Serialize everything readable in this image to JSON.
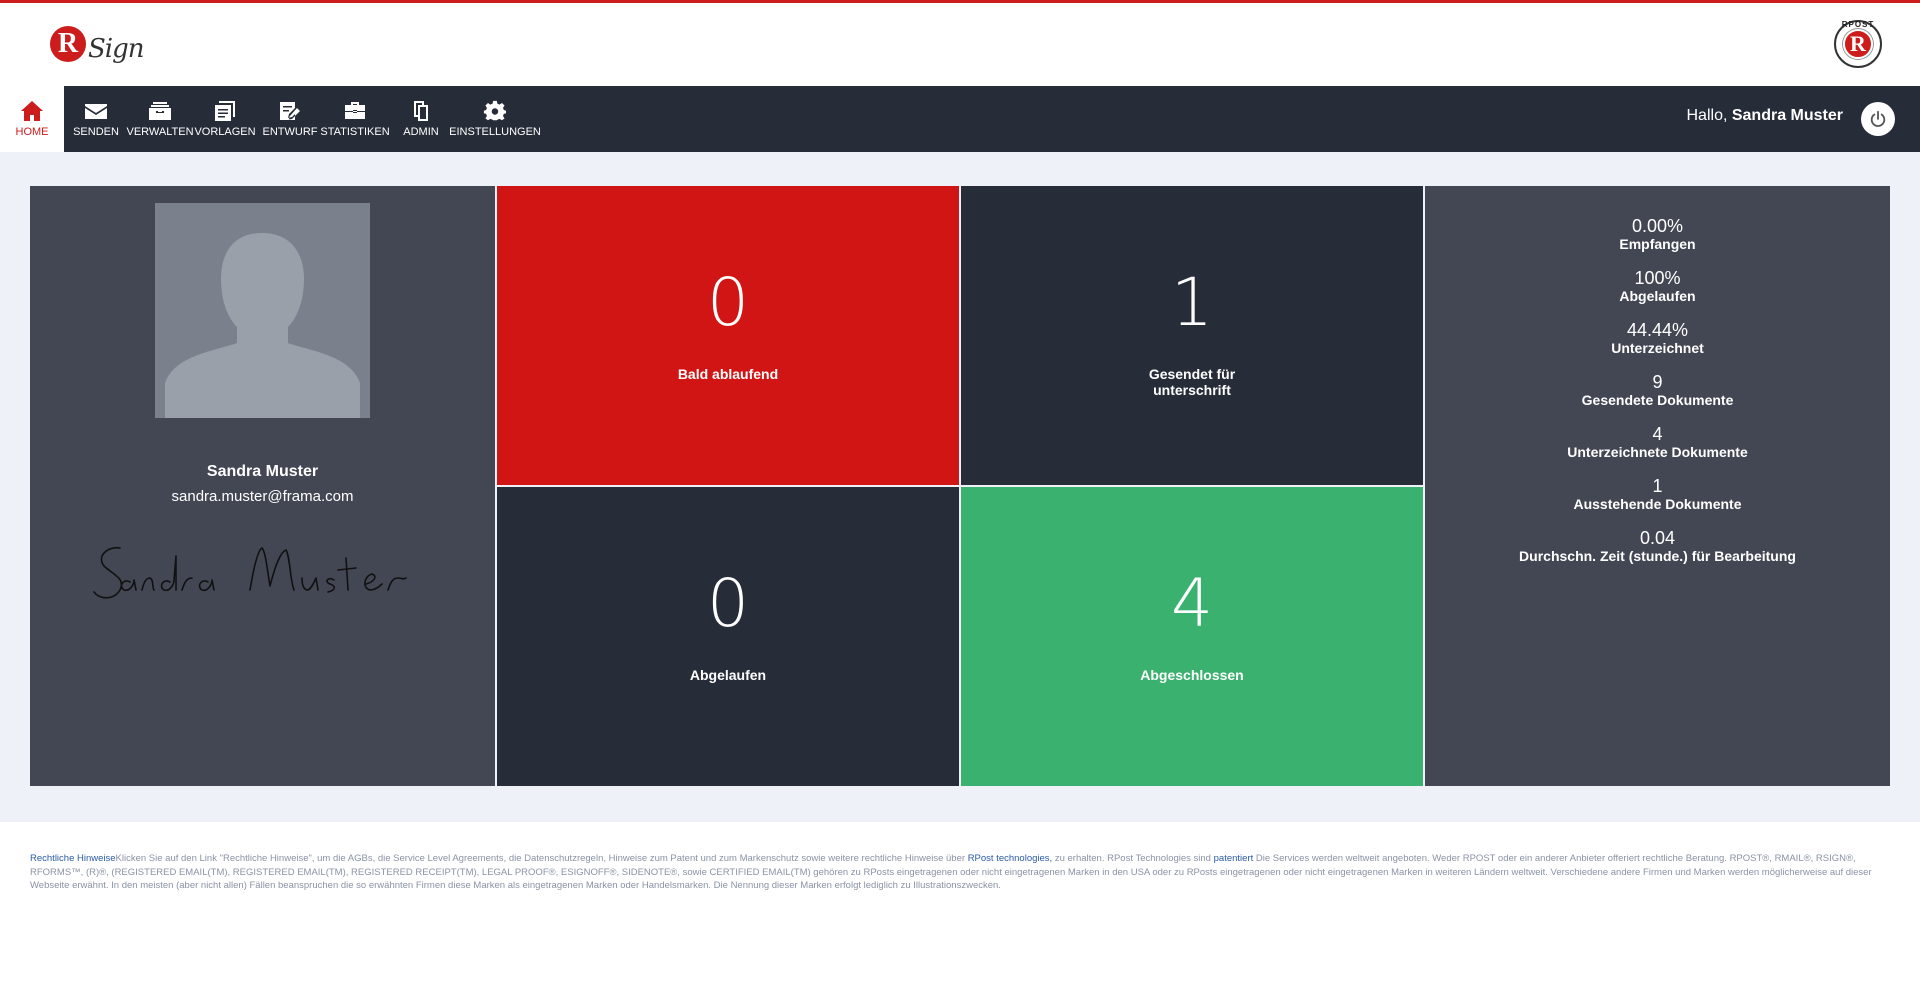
{
  "brand": {
    "logo_letter": "R",
    "logo_text": "Sign",
    "partner_letter": "R",
    "partner_text": "RPOST"
  },
  "nav": {
    "items": [
      {
        "label": "HOME",
        "icon": "home-icon"
      },
      {
        "label": "SENDEN",
        "icon": "envelope-icon"
      },
      {
        "label": "VERWALTEN",
        "icon": "inbox-icon"
      },
      {
        "label": "VORLAGEN",
        "icon": "templates-icon"
      },
      {
        "label": "ENTWURF",
        "icon": "draft-icon"
      },
      {
        "label": "STATISTIKEN",
        "icon": "briefcase-icon"
      },
      {
        "label": "ADMIN",
        "icon": "admin-docs-icon"
      },
      {
        "label": "EINSTELLUNGEN",
        "icon": "gear-icon"
      }
    ],
    "greeting_prefix": "Hallo,",
    "user_name": "Sandra Muster"
  },
  "profile": {
    "name": "Sandra Muster",
    "email": "sandra.muster@frama.com",
    "signature": "Sandra Muster"
  },
  "tiles": [
    {
      "value": "0",
      "label": "Bald ablaufend",
      "color": "#d11514"
    },
    {
      "value": "1",
      "label": "Gesendet für",
      "label2": "unterschrift",
      "color": "#262c38"
    },
    {
      "value": "0",
      "label": "Abgelaufen",
      "color": "#262c38"
    },
    {
      "value": "4",
      "label": "Abgeschlossen",
      "color": "#3bb16f"
    }
  ],
  "stats": [
    {
      "value": "0.00%",
      "label": "Empfangen"
    },
    {
      "value": "100%",
      "label": "Abgelaufen"
    },
    {
      "value": "44.44%",
      "label": "Unterzeichnet"
    },
    {
      "value": "9",
      "label": "Gesendete Dokumente"
    },
    {
      "value": "4",
      "label": "Unterzeichnete Dokumente"
    },
    {
      "value": "1",
      "label": "Ausstehende Dokumente"
    },
    {
      "value": "0.04",
      "label": "Durchschn. Zeit (stunde.) für Bearbeitung"
    }
  ],
  "footer": {
    "legal_link": "Rechtliche Hinweise",
    "text1": "Klicken Sie auf den Link \"Rechtliche Hinweise\", um die AGBs, die Service Level Agreements, die Datenschutzregeln, Hinweise zum Patent und zum Markenschutz sowie weitere rechtliche Hinweise über",
    "rpost_link": "RPost technologies,",
    "text2": "zu erhalten. RPost Technologies sind",
    "patent_link": "patentiert",
    "text3": "Die Services werden weltweit angeboten. Weder RPOST oder ein anderer Anbieter offeriert rechtliche Beratung. RPOST®, RMAIL®, RSIGN®, RFORMS™, (R)®, (REGISTERED EMAIL(TM), REGISTERED EMAIL(TM), REGISTERED RECEIPT(TM), LEGAL PROOF®, ESIGNOFF®, SIDENOTE®, sowie CERTIFIED EMAIL(TM) gehören zu RPosts eingetragenen oder nicht eingetragenen Marken in den USA oder zu RPosts eingetragenen oder nicht eingetragenen Marken in weiteren Ländern weltweit. Verschiedene andere Firmen und Marken werden möglicherweise auf dieser Webseite erwähnt. In den meisten (aber nicht allen) Fällen beanspruchen die so erwähnten Firmen diese Marken als eingetragenen Marken oder Handelsmarken. Die Nennung dieser Marken erfolgt lediglich zu Illustrationszwecken."
  },
  "colors": {
    "accent": "#cc1c1c",
    "nav_bg": "#262c38",
    "panel_bg": "#424753",
    "success": "#3bb16f",
    "danger": "#d11514"
  }
}
